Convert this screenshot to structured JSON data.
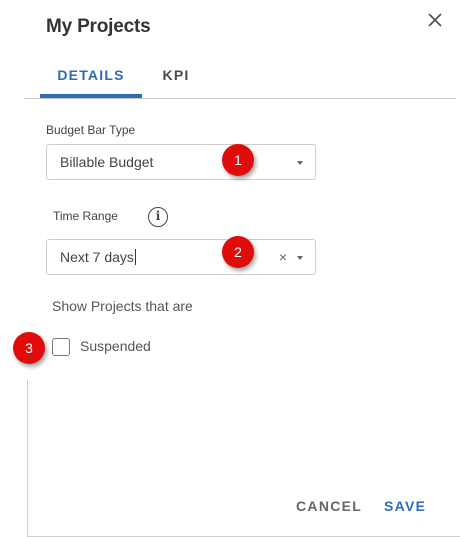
{
  "dialog": {
    "title": "My Projects"
  },
  "tabs": [
    {
      "label": "DETAILS",
      "active": true
    },
    {
      "label": "KPI",
      "active": false
    }
  ],
  "budget_bar": {
    "label": "Budget Bar Type",
    "value": "Billable Budget"
  },
  "time_range": {
    "label": "Time Range",
    "value": "Next 7 days",
    "clear_glyph": "×"
  },
  "show_projects": {
    "title": "Show Projects that are",
    "options": [
      {
        "label": "Suspended",
        "checked": false
      }
    ]
  },
  "annotations": [
    "1",
    "2",
    "3"
  ],
  "actions": {
    "cancel": "CANCEL",
    "save": "SAVE"
  },
  "colors": {
    "accent": "#2f69b8",
    "badge": "#e00c0c"
  },
  "icons": {
    "close": "close-icon",
    "info": "info-icon",
    "caret": "chevron-down-icon"
  }
}
